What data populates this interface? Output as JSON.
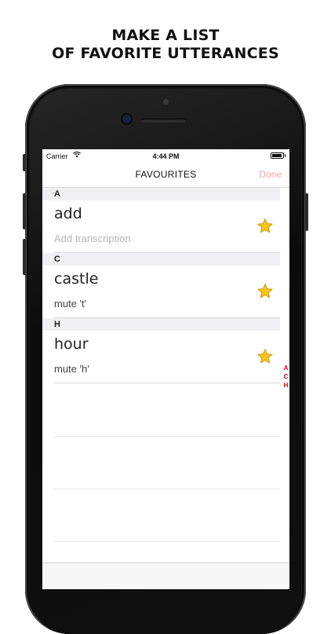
{
  "headline": [
    "MAKE A LIST",
    "OF FAVORITE UTTERANCES"
  ],
  "status_bar": {
    "carrier": "Carrier",
    "time": "4:44 PM",
    "battery_level": 0.9
  },
  "nav": {
    "title": "FAVOURITES",
    "done_label": "Done"
  },
  "sections": [
    {
      "letter": "A",
      "rows": [
        {
          "word": "add",
          "transcription": "Add transcription",
          "is_placeholder": true,
          "favorite": true
        }
      ]
    },
    {
      "letter": "C",
      "rows": [
        {
          "word": "castle",
          "transcription": "mute 't'",
          "is_placeholder": false,
          "favorite": true
        }
      ]
    },
    {
      "letter": "H",
      "rows": [
        {
          "word": "hour",
          "transcription": "mute 'h'",
          "is_placeholder": false,
          "favorite": true
        }
      ]
    }
  ],
  "index_letters": [
    "A",
    "C",
    "H"
  ],
  "icons": {
    "star": "star-icon",
    "wifi": "wifi-icon",
    "battery": "battery-icon"
  },
  "colors": {
    "star_fill": "#F5C518",
    "star_stroke": "#C9960A",
    "done": "#F6A6A6",
    "index": "#D0021B",
    "section_bg": "#EFEFF4"
  }
}
